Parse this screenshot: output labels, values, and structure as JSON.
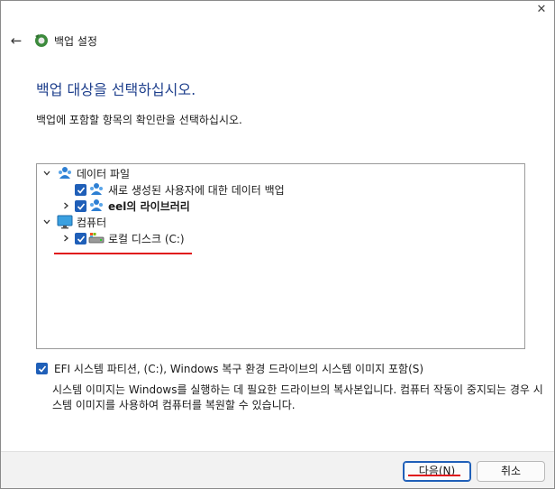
{
  "window": {
    "title": "백업 설정",
    "close_glyph": "✕"
  },
  "header": {
    "back_glyph": "←",
    "heading": "백업 대상을 선택하십시오.",
    "instruction": "백업에 포함할 항목의 확인란을 선택하십시오."
  },
  "tree": {
    "items": [
      {
        "label": "데이터 파일",
        "icon": "users-icon",
        "expanded": true,
        "checkbox": false
      },
      {
        "label": "새로 생성된 사용자에 대한 데이터 백업",
        "icon": "users-icon",
        "checked": true
      },
      {
        "label": "eel의 라이브러리",
        "icon": "user-icon",
        "checked": true,
        "bold": true
      },
      {
        "label": "컴퓨터",
        "icon": "monitor-icon",
        "expanded": true,
        "checkbox": false
      },
      {
        "label": "로컬 디스크 (C:)",
        "icon": "drive-icon",
        "checked": true
      }
    ]
  },
  "efi": {
    "label": "EFI 시스템 파티션, (C:), Windows 복구 환경 드라이브의 시스템 이미지 포함(S)",
    "checked": true,
    "description": "시스템 이미지는 Windows를 실행하는 데 필요한 드라이브의 복사본입니다. 컴퓨터 작동이 중지되는 경우 시스템 이미지를 사용하여 컴퓨터를 복원할 수 있습니다."
  },
  "footer": {
    "next_label": "다음(N)",
    "cancel_label": "취소"
  },
  "colors": {
    "heading": "#1e3f8c",
    "accent": "#1f5fb8",
    "highlight": "#e0161c"
  }
}
